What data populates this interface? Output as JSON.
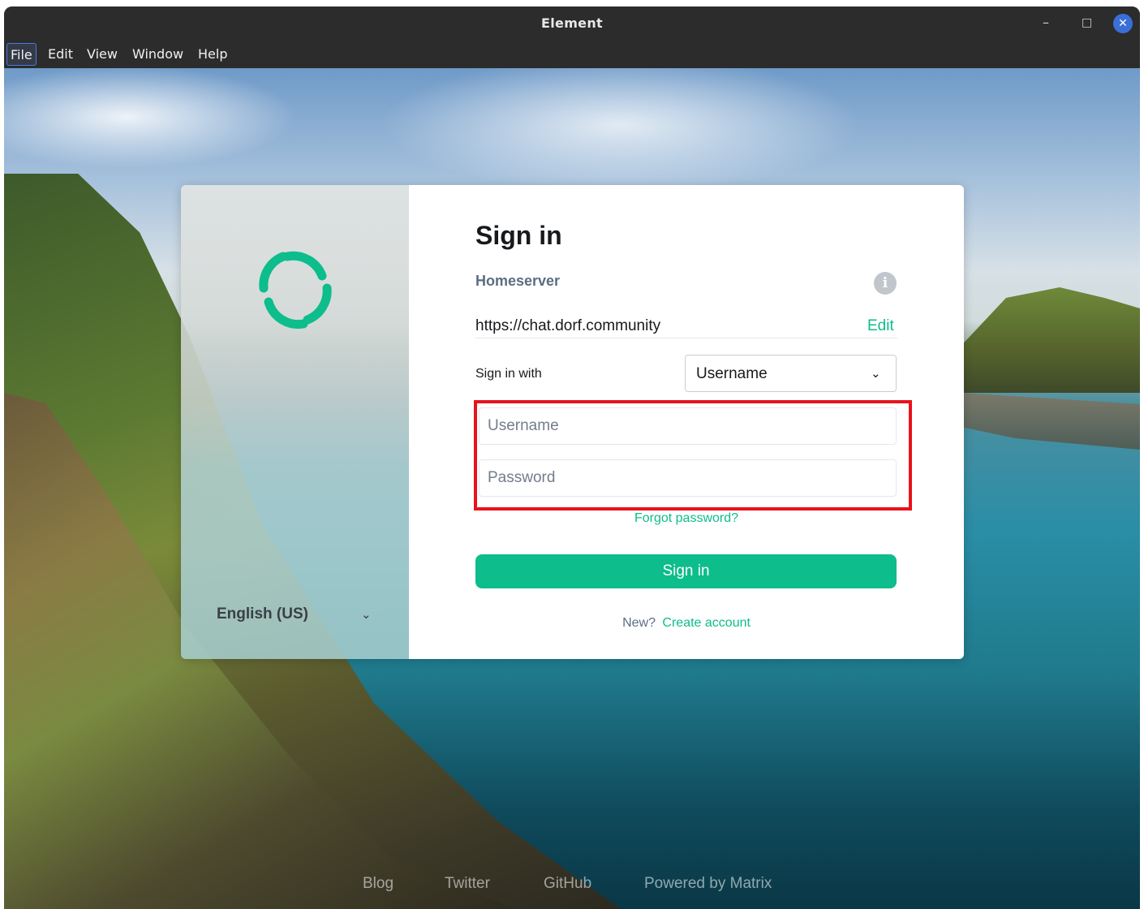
{
  "window": {
    "title": "Element"
  },
  "controls": {
    "minimize": "–",
    "maximize": "□",
    "close": "✕"
  },
  "menubar": {
    "items": [
      "File",
      "Edit",
      "View",
      "Window",
      "Help"
    ]
  },
  "auth": {
    "language": "English (US)",
    "heading": "Sign in",
    "homeserver_label": "Homeserver",
    "homeserver_url": "https://chat.dorf.community",
    "homeserver_edit": "Edit",
    "sign_in_with_label": "Sign in with",
    "sign_in_with_value": "Username",
    "username_placeholder": "Username",
    "password_placeholder": "Password",
    "forgot_password": "Forgot password?",
    "submit": "Sign in",
    "new_prompt": "New?",
    "create_account": "Create account"
  },
  "footer": {
    "links": [
      "Blog",
      "Twitter",
      "GitHub",
      "Powered by Matrix"
    ]
  },
  "colors": {
    "accent": "#0dbd8b",
    "highlight": "#e8131b",
    "secondary_text": "#5c6d82"
  },
  "icons": {
    "info": "info-icon",
    "chevron": "chevron-down-icon",
    "logo": "element-logo-icon"
  }
}
